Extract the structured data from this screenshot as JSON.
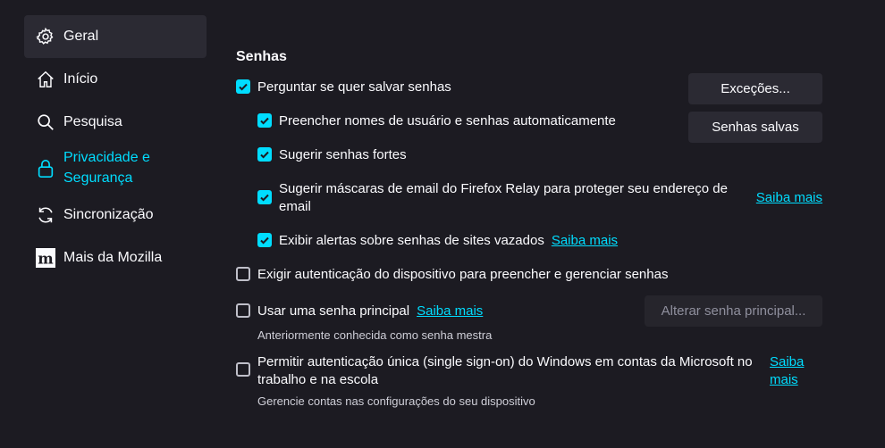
{
  "sidebar": {
    "items": [
      {
        "label": "Geral",
        "icon": "gear-icon"
      },
      {
        "label": "Início",
        "icon": "home-icon"
      },
      {
        "label": "Pesquisa",
        "icon": "search-icon"
      },
      {
        "label": "Privacidade e Segurança",
        "icon": "lock-icon"
      },
      {
        "label": "Sincronização",
        "icon": "sync-icon"
      },
      {
        "label": "Mais da Mozilla",
        "icon": "mozilla-icon"
      }
    ]
  },
  "passwords": {
    "title": "Senhas",
    "ask_save": "Perguntar se quer salvar senhas",
    "autofill": "Preencher nomes de usuário e senhas automaticamente",
    "suggest_strong": "Sugerir senhas fortes",
    "relay": "Sugerir máscaras de email do Firefox Relay para proteger seu endereço de email",
    "breach_alerts": "Exibir alertas sobre senhas de sites vazados",
    "device_auth": "Exigir autenticação do dispositivo para preencher e gerenciar senhas",
    "primary_password": "Usar uma senha principal",
    "primary_password_sub": "Anteriormente conhecida como senha mestra",
    "sso": "Permitir autenticação única (single sign-on) do Windows em contas da Microsoft no trabalho e na escola",
    "sso_sub": "Gerencie contas nas configurações do seu dispositivo",
    "learn_more": "Saiba mais",
    "btn_exceptions": "Exceções...",
    "btn_saved": "Senhas salvas",
    "btn_change_primary": "Alterar senha principal..."
  },
  "colors": {
    "accent": "#00ddff",
    "background": "#1c1b22",
    "button": "#2b2a33"
  }
}
